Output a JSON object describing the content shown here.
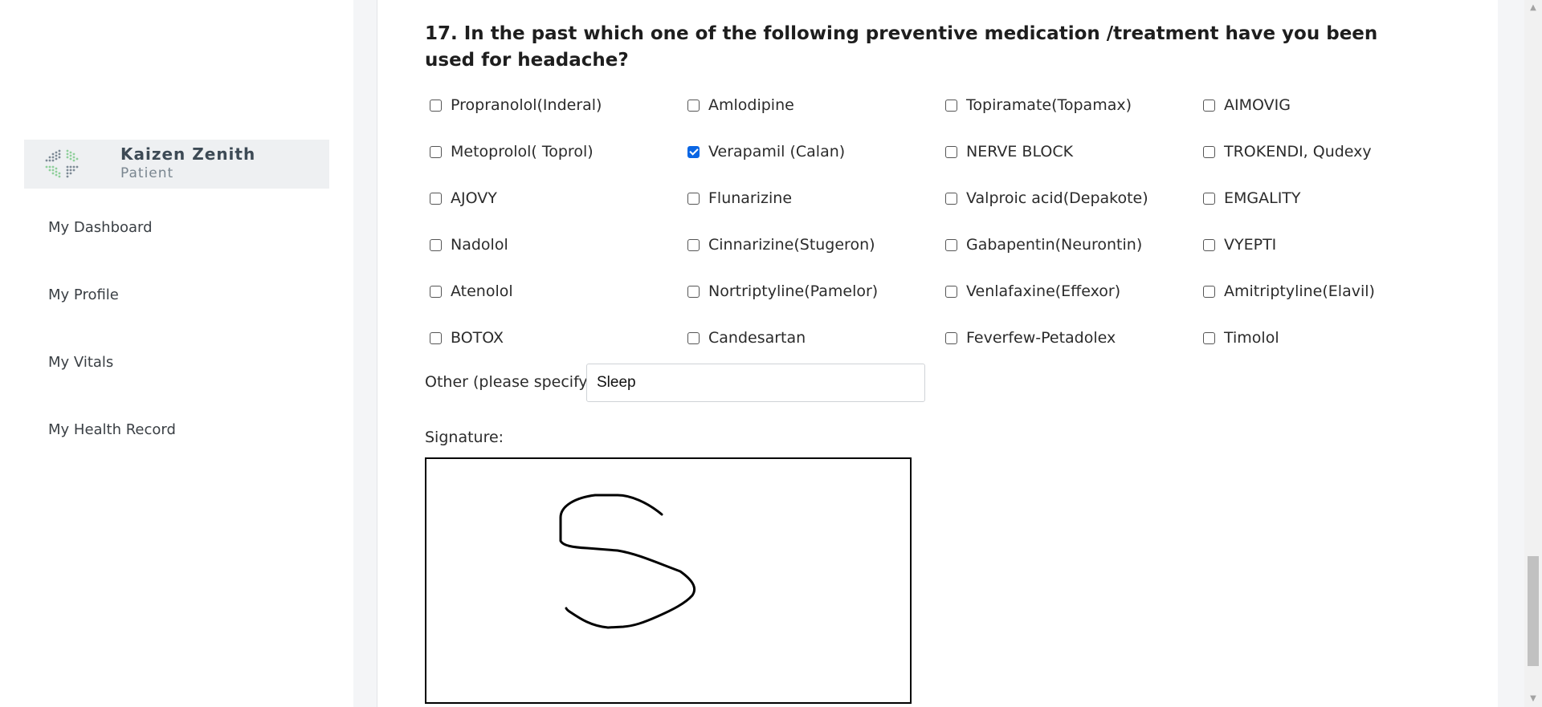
{
  "app": {
    "logo_title": "Kaizen Zenith",
    "logo_subtitle": "Patient"
  },
  "sidebar": {
    "items": [
      {
        "label": "My Dashboard"
      },
      {
        "label": "My Profile"
      },
      {
        "label": "My Vitals"
      },
      {
        "label": "My Health Record"
      }
    ]
  },
  "form": {
    "question": "17. In the past which one of the following preventive medication /treatment have you been used for headache?",
    "options": [
      {
        "label": "Propranolol(Inderal)",
        "checked": false
      },
      {
        "label": "Amlodipine",
        "checked": false
      },
      {
        "label": "Topiramate(Topamax)",
        "checked": false
      },
      {
        "label": "AIMOVIG",
        "checked": false
      },
      {
        "label": "Metoprolol( Toprol)",
        "checked": false
      },
      {
        "label": "Verapamil (Calan)",
        "checked": true
      },
      {
        "label": "NERVE BLOCK",
        "checked": false
      },
      {
        "label": "TROKENDI, Qudexy",
        "checked": false
      },
      {
        "label": "AJOVY",
        "checked": false
      },
      {
        "label": "Flunarizine",
        "checked": false
      },
      {
        "label": "Valproic acid(Depakote)",
        "checked": false
      },
      {
        "label": "EMGALITY",
        "checked": false
      },
      {
        "label": "Nadolol",
        "checked": false
      },
      {
        "label": "Cinnarizine(Stugeron)",
        "checked": false
      },
      {
        "label": "Gabapentin(Neurontin)",
        "checked": false
      },
      {
        "label": "VYEPTI",
        "checked": false
      },
      {
        "label": "Atenolol",
        "checked": false
      },
      {
        "label": "Nortriptyline(Pamelor)",
        "checked": false
      },
      {
        "label": "Venlafaxine(Effexor)",
        "checked": false
      },
      {
        "label": "Amitriptyline(Elavil)",
        "checked": false
      },
      {
        "label": "BOTOX",
        "checked": false
      },
      {
        "label": "Candesartan",
        "checked": false
      },
      {
        "label": "Feverfew-Petadolex",
        "checked": false
      },
      {
        "label": "Timolol",
        "checked": false
      }
    ],
    "other_label": "Other (please specify):",
    "other_value": "Sleep",
    "signature_label": "Signature:"
  },
  "colors": {
    "checkbox_accent": "#0a66e4",
    "logo_bg": "#eef0f2"
  }
}
